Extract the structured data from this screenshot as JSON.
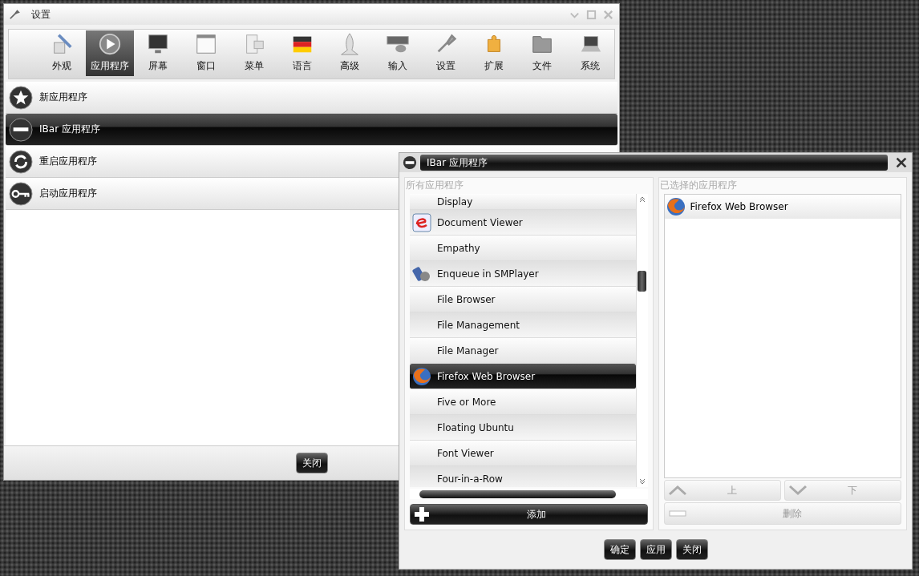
{
  "main_window": {
    "title": "设置",
    "toolbar": [
      {
        "label": "外观",
        "selected": false
      },
      {
        "label": "应用程序",
        "selected": true
      },
      {
        "label": "屏幕",
        "selected": false
      },
      {
        "label": "窗口",
        "selected": false
      },
      {
        "label": "菜单",
        "selected": false
      },
      {
        "label": "语言",
        "selected": false
      },
      {
        "label": "高级",
        "selected": false
      },
      {
        "label": "输入",
        "selected": false
      },
      {
        "label": "设置",
        "selected": false
      },
      {
        "label": "扩展",
        "selected": false
      },
      {
        "label": "文件",
        "selected": false
      },
      {
        "label": "系统",
        "selected": false
      }
    ],
    "items": [
      {
        "label": "新应用程序",
        "selected": false
      },
      {
        "label": "IBar 应用程序",
        "selected": true
      },
      {
        "label": "重启应用程序",
        "selected": false
      },
      {
        "label": "启动应用程序",
        "selected": false
      }
    ],
    "close_button": "关闭"
  },
  "dialog": {
    "title": "IBar 应用程序",
    "all_apps": {
      "label": "所有应用程序",
      "items": [
        {
          "label": "Display",
          "selected": false
        },
        {
          "label": "Document Viewer",
          "selected": false
        },
        {
          "label": "Empathy",
          "selected": false
        },
        {
          "label": "Enqueue in SMPlayer",
          "selected": false
        },
        {
          "label": "File Browser",
          "selected": false
        },
        {
          "label": "File Management",
          "selected": false
        },
        {
          "label": "File Manager",
          "selected": false
        },
        {
          "label": "Firefox Web Browser",
          "selected": true
        },
        {
          "label": "Five or More",
          "selected": false
        },
        {
          "label": "Floating Ubuntu",
          "selected": false
        },
        {
          "label": "Font Viewer",
          "selected": false
        },
        {
          "label": "Four-in-a-Row",
          "selected": false
        }
      ],
      "add_button": "添加"
    },
    "selected_apps": {
      "label": "已选择的应用程序",
      "items": [
        {
          "label": "Firefox Web Browser"
        }
      ],
      "up_button": "上",
      "down_button": "下",
      "delete_button": "删除"
    },
    "buttons": [
      "确定",
      "应用",
      "关闭"
    ]
  }
}
